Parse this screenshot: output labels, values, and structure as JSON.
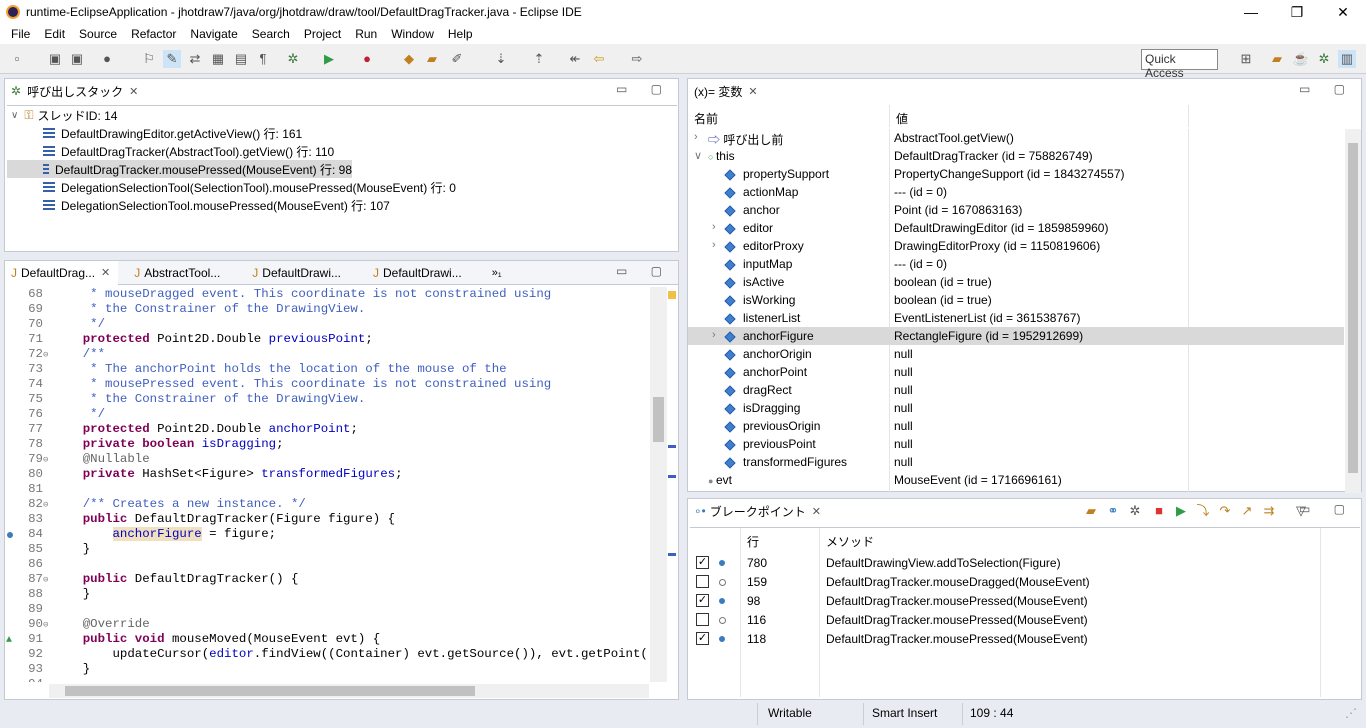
{
  "window": {
    "title": "runtime-EclipseApplication - jhotdraw7/java/org/jhotdraw/draw/tool/DefaultDragTracker.java - Eclipse IDE",
    "min": "—",
    "restore": "❐",
    "close": "✕"
  },
  "menu": [
    "File",
    "Edit",
    "Source",
    "Refactor",
    "Navigate",
    "Search",
    "Project",
    "Run",
    "Window",
    "Help"
  ],
  "toolbar": {
    "quick_access": "Quick Access"
  },
  "callstack": {
    "title": "呼び出しスタック",
    "thread": "スレッドID: 14",
    "frames": [
      "DefaultDrawingEditor.getActiveView() 行: 161",
      "DefaultDragTracker(AbstractTool).getView() 行: 110",
      "DefaultDragTracker.mousePressed(MouseEvent) 行: 98",
      "DelegationSelectionTool(SelectionTool).mousePressed(MouseEvent) 行: 0",
      "DelegationSelectionTool.mousePressed(MouseEvent) 行: 107"
    ]
  },
  "editor": {
    "tabs": [
      "DefaultDrag...",
      "AbstractTool...",
      "DefaultDrawi...",
      "DefaultDrawi..."
    ],
    "overflow": "»₁"
  },
  "variables": {
    "title": "(x)= 変数",
    "col_name": "名前",
    "col_value": "値",
    "rows": [
      {
        "name": "呼び出し前",
        "value": "AbstractTool.getView()"
      },
      {
        "name": "this",
        "value": "DefaultDragTracker (id = 758826749)"
      },
      {
        "name": "propertySupport",
        "value": "PropertyChangeSupport (id = 1843274557)"
      },
      {
        "name": "actionMap",
        "value": "--- (id = 0)"
      },
      {
        "name": "anchor",
        "value": "Point (id = 1670863163)"
      },
      {
        "name": "editor",
        "value": "DefaultDrawingEditor (id = 1859859960)"
      },
      {
        "name": "editorProxy",
        "value": "DrawingEditorProxy (id = 1150819606)"
      },
      {
        "name": "inputMap",
        "value": "--- (id = 0)"
      },
      {
        "name": "isActive",
        "value": "boolean (id = true)"
      },
      {
        "name": "isWorking",
        "value": "boolean (id = true)"
      },
      {
        "name": "listenerList",
        "value": "EventListenerList (id = 361538767)"
      },
      {
        "name": "anchorFigure",
        "value": "RectangleFigure (id = 1952912699)"
      },
      {
        "name": "anchorOrigin",
        "value": "null"
      },
      {
        "name": "anchorPoint",
        "value": "null"
      },
      {
        "name": "dragRect",
        "value": "null"
      },
      {
        "name": "isDragging",
        "value": "null"
      },
      {
        "name": "previousOrigin",
        "value": "null"
      },
      {
        "name": "previousPoint",
        "value": "null"
      },
      {
        "name": "transformedFigures",
        "value": "null"
      },
      {
        "name": "evt",
        "value": "MouseEvent (id = 1716696161)"
      }
    ]
  },
  "breakpoints": {
    "title": "ブレークポイント",
    "col_line": "行",
    "col_method": "メソッド",
    "rows": [
      {
        "checked": "✓",
        "line": "780",
        "method": "DefaultDrawingView.addToSelection(Figure)"
      },
      {
        "checked": "",
        "line": "159",
        "method": "DefaultDragTracker.mouseDragged(MouseEvent)"
      },
      {
        "checked": "✓",
        "line": "98",
        "method": "DefaultDragTracker.mousePressed(MouseEvent)"
      },
      {
        "checked": "",
        "line": "116",
        "method": "DefaultDragTracker.mousePressed(MouseEvent)"
      },
      {
        "checked": "✓",
        "line": "118",
        "method": "DefaultDragTracker.mousePressed(MouseEvent)"
      }
    ]
  },
  "status": {
    "writable": "Writable",
    "insert": "Smart Insert",
    "position": "109 : 44"
  }
}
